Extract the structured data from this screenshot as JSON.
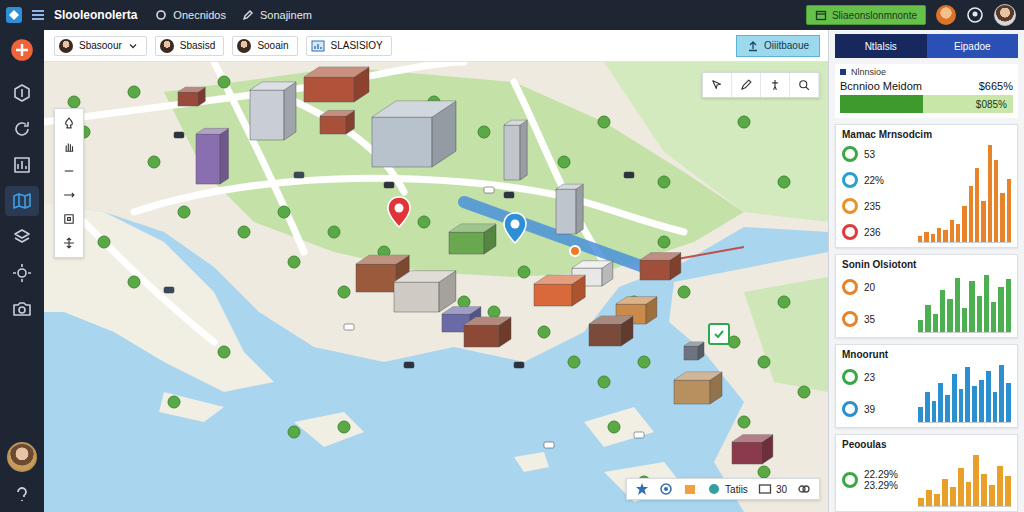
{
  "app": {
    "title": "Slooleonolerta"
  },
  "top_nav": [
    "Onecnidos",
    "Sonajinem"
  ],
  "top_action": "Sliaeonslonmnonte",
  "sidebar": {
    "items": [
      {
        "selected": false
      },
      {
        "selected": false
      },
      {
        "selected": false
      },
      {
        "selected": true
      },
      {
        "selected": false
      },
      {
        "selected": false
      },
      {
        "selected": false
      }
    ]
  },
  "filters": [
    {
      "label": "Sbasoour",
      "dropdown": true
    },
    {
      "label": "Sbasisd",
      "dropdown": false
    },
    {
      "label": "Sooain",
      "dropdown": false
    },
    {
      "label": "SLASISIOY",
      "dropdown": false
    }
  ],
  "filter_action": "Oiiitbaoue",
  "markers": [
    {
      "kind": "pin",
      "color": "#e0343a"
    },
    {
      "kind": "pin",
      "color": "#2f8fd6"
    },
    {
      "kind": "dot",
      "color": "#f07a2a"
    },
    {
      "kind": "badge",
      "color": "#2fa84f"
    }
  ],
  "map_status": [
    "Tatiis",
    "30"
  ],
  "panel_tabs": [
    {
      "label": "Ntlalsis",
      "selected": true
    },
    {
      "label": "Eipadoe",
      "selected": false
    }
  ],
  "summary": {
    "caption": "Nlnnsioe",
    "label": "Bcnnioo Meidom",
    "value": "$665%",
    "bar_text": "$085%",
    "level": 0.48
  },
  "cards": [
    {
      "title": "Mamac Mrnsodcim",
      "color": "#e8832a",
      "stats": [
        {
          "value": "53",
          "color": "#3aa845"
        },
        {
          "value": "22%",
          "color": "#2b9fd0"
        },
        {
          "value": "235",
          "color": "#e8922a"
        },
        {
          "value": "236",
          "color": "#e03a3a"
        }
      ],
      "bars": [
        6,
        10,
        8,
        14,
        12,
        22,
        18,
        35,
        55,
        72,
        40,
        95,
        80,
        48,
        62
      ]
    },
    {
      "title": "Sonin Olsiotont",
      "color": "#4caf50",
      "stats": [
        {
          "value": "20",
          "color": "#e8832a"
        },
        {
          "value": "35",
          "color": "#e8832a"
        }
      ],
      "bars": [
        20,
        45,
        30,
        70,
        55,
        90,
        40,
        85,
        60,
        95,
        50,
        75,
        88
      ]
    },
    {
      "title": "Mnoorunt",
      "color": "#2b8fd0",
      "stats": [
        {
          "value": "23",
          "color": "#3aa845"
        },
        {
          "value": "39",
          "color": "#2b8fd0"
        }
      ],
      "bars": [
        25,
        50,
        35,
        65,
        45,
        80,
        55,
        92,
        60,
        70,
        85,
        50,
        95,
        65
      ]
    },
    {
      "title": "Peooulas",
      "color": "#e8a02a",
      "stats": [
        {
          "value": "22.29%",
          "sub": "23.29%",
          "color": "#3aa845"
        }
      ],
      "bars": [
        15,
        30,
        22,
        50,
        35,
        70,
        45,
        95,
        60,
        40,
        75,
        55
      ]
    }
  ]
}
